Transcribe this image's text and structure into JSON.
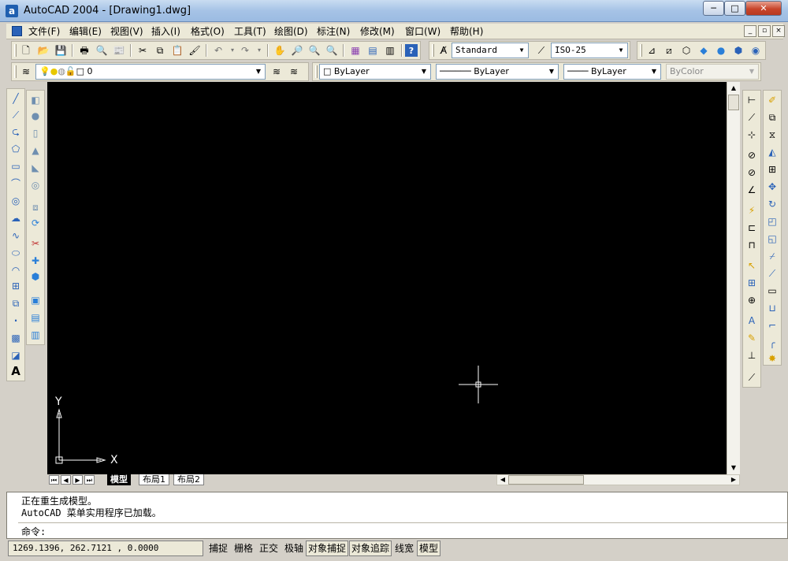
{
  "window": {
    "app_icon_letter": "a",
    "title": "AutoCAD 2004 - [Drawing1.dwg]",
    "min_glyph": "─",
    "max_glyph": "□",
    "close_glyph": "✕"
  },
  "menubar": {
    "items": [
      {
        "label": "文件(F)"
      },
      {
        "label": "编辑(E)"
      },
      {
        "label": "视图(V)"
      },
      {
        "label": "插入(I)"
      },
      {
        "label": "格式(O)"
      },
      {
        "label": "工具(T)"
      },
      {
        "label": "绘图(D)"
      },
      {
        "label": "标注(N)"
      },
      {
        "label": "修改(M)"
      },
      {
        "label": "窗口(W)"
      },
      {
        "label": "帮助(H)"
      }
    ],
    "doc_min": "_",
    "doc_max": "▫",
    "doc_close": "×"
  },
  "standard_toolbar": {
    "text_style": "Standard",
    "dim_style": "ISO-25"
  },
  "layers_toolbar": {
    "current_layer": "0"
  },
  "properties_toolbar": {
    "color": "ByLayer",
    "linetype": "ByLayer",
    "lineweight": "ByLayer",
    "plotstyle": "ByColor"
  },
  "canvas": {
    "background": "#000000",
    "ucs_y": "Y",
    "ucs_x": "X"
  },
  "layout_tabs": [
    {
      "label": "模型"
    },
    {
      "label": "布局1"
    },
    {
      "label": "布局2"
    }
  ],
  "command_window": {
    "line1": "正在重生成模型。",
    "line2": "AutoCAD 菜单实用程序已加载。",
    "prompt": "命令:"
  },
  "statusbar": {
    "coords": "1269.1396, 262.7121 , 0.0000",
    "buttons": [
      {
        "label": "捕捉"
      },
      {
        "label": "栅格"
      },
      {
        "label": "正交"
      },
      {
        "label": "极轴"
      },
      {
        "label": "对象捕捉"
      },
      {
        "label": "对象追踪"
      },
      {
        "label": "线宽"
      },
      {
        "label": "模型"
      }
    ]
  },
  "colors": {
    "accent": "#1f5fb0",
    "toolbar_bg": "#ece9d8",
    "canvas_bg": "#000000"
  }
}
